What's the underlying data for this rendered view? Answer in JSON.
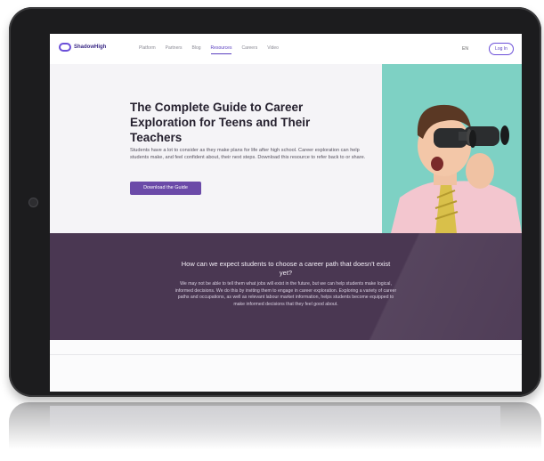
{
  "nav": {
    "logo_text": "ShadowHigh",
    "items": [
      {
        "label": "Platform",
        "active": false
      },
      {
        "label": "Partners",
        "active": false
      },
      {
        "label": "Blog",
        "active": false
      },
      {
        "label": "Resources",
        "active": true
      },
      {
        "label": "Careers",
        "active": false
      },
      {
        "label": "Video",
        "active": false
      }
    ],
    "lang": "EN",
    "login_label": "Log In"
  },
  "hero": {
    "title": "The Complete Guide to Career Exploration for Teens and Their Teachers",
    "text": "Students have a lot to consider as they make plans for life after high school. Career exploration can help students make, and feel confident about, their next steps. Download this resource to refer back to or share.",
    "button_label": "Download the Guide"
  },
  "band": {
    "title": "How can we expect students to choose a career path that doesn't exist yet?",
    "text": "We may not be able to tell them what jobs will exist in the future, but we can help students make logical, informed decisions. We do this by inviting them to engage in career exploration. Exploring a variety of career paths and occupations, as well as relevant labour market information, helps students become equipped to make informed decisions that they feel good about."
  },
  "colors": {
    "accent": "#6b4aa8",
    "hero_photo_bg": "#7ed1c4",
    "band_bg": "#4a3752"
  },
  "icons": {
    "logo": "logo-mark-icon",
    "camera": "camera-icon"
  }
}
